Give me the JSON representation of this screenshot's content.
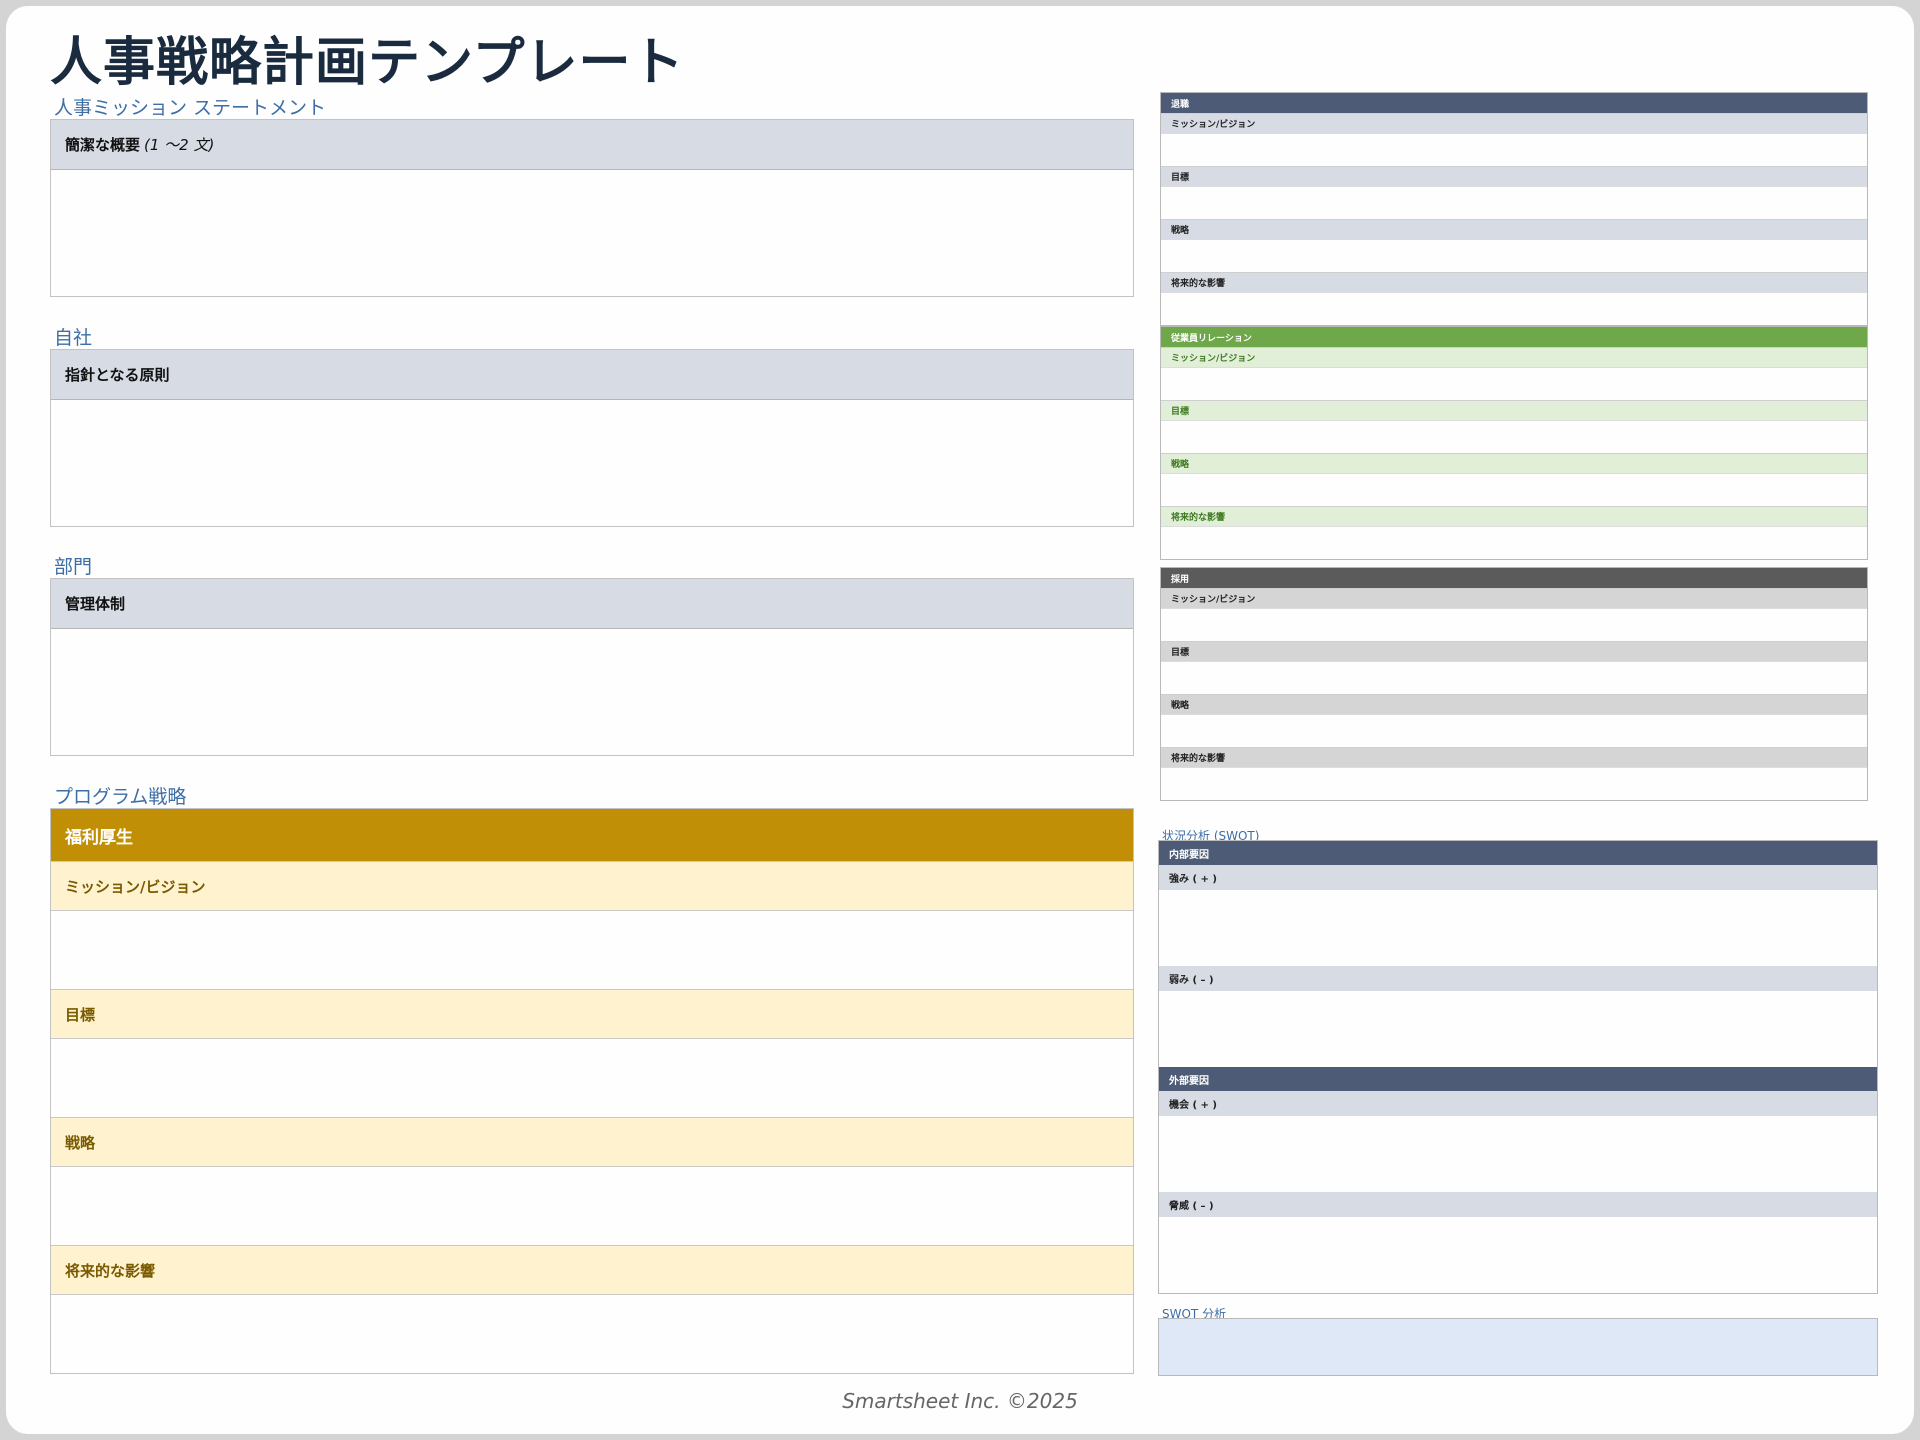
{
  "title": "人事戦略計画テンプレート",
  "mission": {
    "label": "人事ミッション ステートメント",
    "head": "簡潔な概要",
    "hint": "(1 ～2 文)"
  },
  "company": {
    "label": "自社",
    "head": "指針となる原則"
  },
  "department": {
    "label": "部門",
    "head": "管理体制"
  },
  "program": {
    "label": "プログラム戦略",
    "head": "福利厚生",
    "rows": [
      "ミッション/ビジョン",
      "目標",
      "戦略",
      "将来的な影響"
    ]
  },
  "right_tables": [
    {
      "head": "退職",
      "rows": [
        "ミッション/ビジョン",
        "目標",
        "戦略",
        "将来的な影響"
      ]
    },
    {
      "head": "従業員リレーション",
      "rows": [
        "ミッション/ビジョン",
        "目標",
        "戦略",
        "将来的な影響"
      ]
    },
    {
      "head": "採用",
      "rows": [
        "ミッション/ビジョン",
        "目標",
        "戦略",
        "将来的な影響"
      ]
    }
  ],
  "swot": {
    "label": "状況分析 (SWOT)",
    "internal": {
      "head": "内部要因",
      "rows": [
        "強み ( + )",
        "弱み ( – )"
      ]
    },
    "external": {
      "head": "外部要因",
      "rows": [
        "機会 ( + )",
        "脅威 ( – )"
      ]
    },
    "analysis_label": "SWOT 分析"
  },
  "footer": "Smartsheet Inc. ©2025",
  "colors": {
    "title": "#1a2b3f",
    "section_label": "#3d6ea6",
    "gray_header": "#d6dbe4",
    "gold": "#c08f06",
    "gold_light": "#fff3cf",
    "navy": "#4d5b76",
    "green": "#6ea84b",
    "green_light": "#e1eed8",
    "dark_gray": "#5b5b5b",
    "swot_fill": "#dfe8f7"
  }
}
